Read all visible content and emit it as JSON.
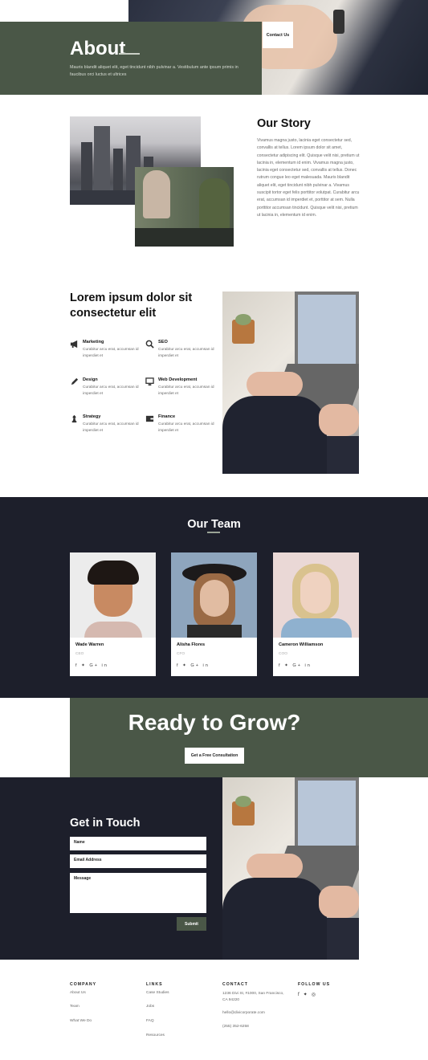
{
  "hero": {
    "title": "About",
    "text": "Mauris blandit aliquet elit, eget tincidunt nibh pulvinar a. Vestibulum ante ipsum primis in faucibus orci luctus et ultrices",
    "contact_label": "Contact Us"
  },
  "story": {
    "title": "Our Story",
    "text": "Vivamus magna justo, lacinia eget consectetur sed, convallis at tellus. Lorem ipsum dolor sit amet, consectetur adipiscing elit. Quisque velit nisi, pretium ut lacinia in, elementum id enim. Vivamus magna justo, lacinia eget consectetur sed, convallis at tellus. Donec rutrum congue leo eget malesuada. Mauris blandit aliquet elit, eget tincidunt nibh pulvinar a. Vivamus suscipit tortor eget felis porttitor volutpat. Curabitur arcu erat, accumsan id imperdiet et, porttitor at sem. Nulla porttitor accumsan tincidunt. Quisque velit nisi, pretium ut lacinia in, elementum id enim."
  },
  "services": {
    "title": "Lorem ipsum dolor sit consectetur elit",
    "items": [
      {
        "name": "Marketing",
        "desc": "Curabitur arcu erat, accumsan id imperdiet et",
        "icon": "megaphone-icon"
      },
      {
        "name": "SEO",
        "desc": "Curabitur arcu erat, accumsan id imperdiet et",
        "icon": "search-icon"
      },
      {
        "name": "Design",
        "desc": "Curabitur arcu erat, accumsan id imperdiet et",
        "icon": "pencil-icon"
      },
      {
        "name": "Web Development",
        "desc": "Curabitur arcu erat, accumsan id imperdiet et",
        "icon": "monitor-icon"
      },
      {
        "name": "Strategy",
        "desc": "Curabitur arcu erat, accumsan id imperdiet et",
        "icon": "chess-icon"
      },
      {
        "name": "Finance",
        "desc": "Curabitur arcu erat, accumsan id imperdiet et",
        "icon": "wallet-icon"
      }
    ]
  },
  "team": {
    "title": "Our Team",
    "members": [
      {
        "name": "Wade Warren",
        "role": "CEO",
        "social": "f  ✦  G+  in"
      },
      {
        "name": "Alisha Flores",
        "role": "CFO",
        "social": "f  ✦  G+  in"
      },
      {
        "name": "Cameron Williamson",
        "role": "COO",
        "social": "f  ✦  G+  in"
      }
    ]
  },
  "cta": {
    "title": "Ready to Grow?",
    "button": "Get a Free Consultation"
  },
  "contact": {
    "title": "Get in Touch",
    "name_placeholder": "Name",
    "email_placeholder": "Email Address",
    "message_placeholder": "Message",
    "submit": "Submit"
  },
  "footer": {
    "company": {
      "heading": "COMPANY",
      "links": [
        "About Us",
        "Team",
        "What We Do"
      ]
    },
    "links": {
      "heading": "LINKS",
      "links": [
        "Case Studies",
        "Jobs",
        "FAQ",
        "Resources"
      ]
    },
    "contact": {
      "heading": "CONTACT",
      "address": "1236 Divi St, #1000, San Francisco, CA 94220",
      "email": "hello@divicorporate.com",
      "phone": "(255) 352-6258"
    },
    "follow": {
      "heading": "FOLLOW US",
      "icons": [
        "facebook-icon",
        "twitter-icon",
        "instagram-icon"
      ]
    }
  },
  "colors": {
    "accent_green": "#4a5747",
    "dark_navy": "#1d1f2b"
  }
}
